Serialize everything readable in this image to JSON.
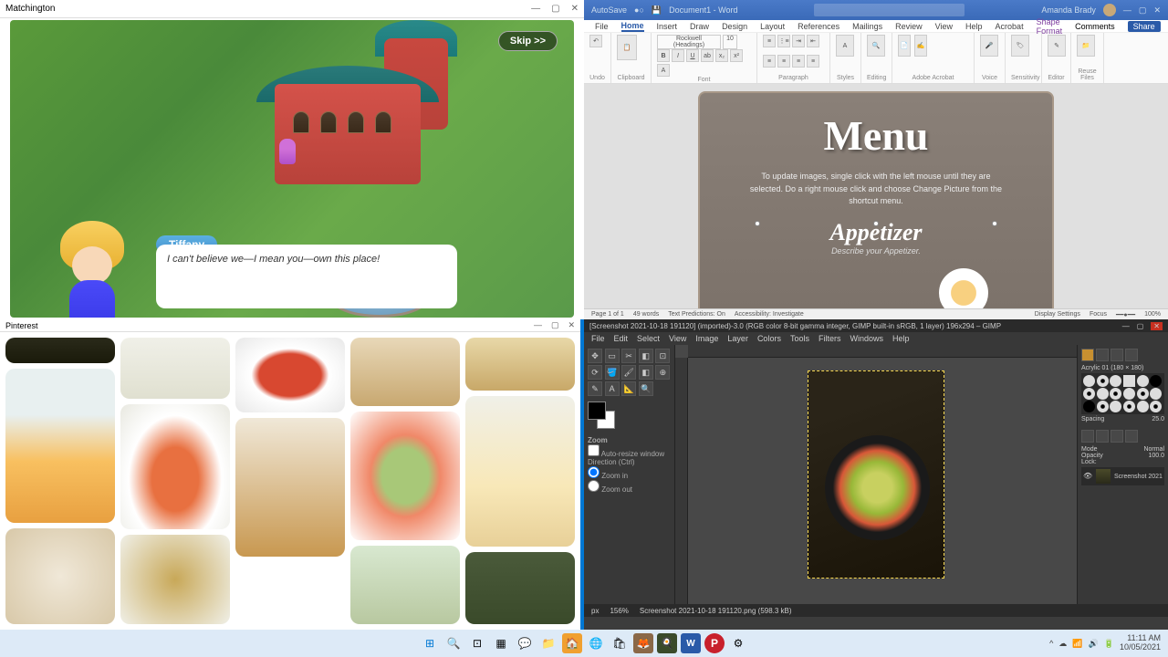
{
  "game": {
    "window_title": "Matchington",
    "skip": "Skip >>",
    "speaker": "Tiffany",
    "line": "I can't believe we—I mean you—own this place!"
  },
  "word": {
    "autosave": "AutoSave",
    "titlebar_doc": "Document1 - Word",
    "user": "Amanda Brady",
    "comments": "Comments",
    "share": "Share",
    "tabs": {
      "file": "File",
      "home": "Home",
      "insert": "Insert",
      "draw": "Draw",
      "design": "Design",
      "layout": "Layout",
      "references": "References",
      "mailings": "Mailings",
      "review": "Review",
      "view": "View",
      "help": "Help",
      "acrobat": "Acrobat",
      "shape_format": "Shape Format"
    },
    "ribbon": {
      "undo": "Undo",
      "clipboard": "Clipboard",
      "paste": "Paste",
      "font": "Font",
      "font_name": "Rockwell (Headings)",
      "font_size": "10",
      "paragraph": "Paragraph",
      "styles": "Styles",
      "editing": "Editing",
      "adobe": "Create and Share Adobe PDF",
      "req_sig": "Request Signatures",
      "adobe_grp": "Adobe Acrobat",
      "dictate": "Dictate",
      "voice": "Voice",
      "sensitivity": "Sensitivity",
      "editor": "Editor",
      "reuse": "Reuse Files"
    },
    "doc": {
      "title": "Menu",
      "desc": "To update images, single click with the left mouse until they are selected. Do a right mouse click and choose Change Picture from the shortcut menu.",
      "section": "Appetizer",
      "section_sub": "Describe your Appetizer."
    },
    "status": {
      "page": "Page 1 of 1",
      "words": "49 words",
      "predictions": "Text Predictions: On",
      "access": "Accessibility: Investigate",
      "display": "Display Settings",
      "focus": "Focus",
      "zoom": "100%"
    }
  },
  "pinterest": {
    "title": "Pinterest"
  },
  "gimp": {
    "title": "[Screenshot 2021-10-18 191120] (imported)-3.0 (RGB color 8-bit gamma integer, GIMP built-in sRGB, 1 layer) 196x294 – GIMP",
    "menu": {
      "file": "File",
      "edit": "Edit",
      "select": "Select",
      "view": "View",
      "image": "Image",
      "layer": "Layer",
      "colors": "Colors",
      "tools": "Tools",
      "filters": "Filters",
      "windows": "Windows",
      "help": "Help"
    },
    "tool_options": {
      "header": "Zoom",
      "auto_resize": "Auto-resize window",
      "direction": "Direction (Ctrl)",
      "zoom_in": "Zoom in",
      "zoom_out": "Zoom out"
    },
    "dock": {
      "brush_tab": "Acrylic 01 (180 × 180)",
      "mode": "Mode",
      "mode_val": "Normal",
      "opacity": "Opacity",
      "opacity_val": "100.0",
      "spacing": "Spacing",
      "spacing_val": "25.0",
      "lock": "Lock:",
      "layer": "Screenshot 2021"
    },
    "status": {
      "px": "px",
      "zoom": "156%",
      "file": "Screenshot 2021-10-18 191120.png (598.3 kB)"
    }
  },
  "taskbar": {
    "time": "11:11 AM",
    "date": "10/05/2021"
  }
}
